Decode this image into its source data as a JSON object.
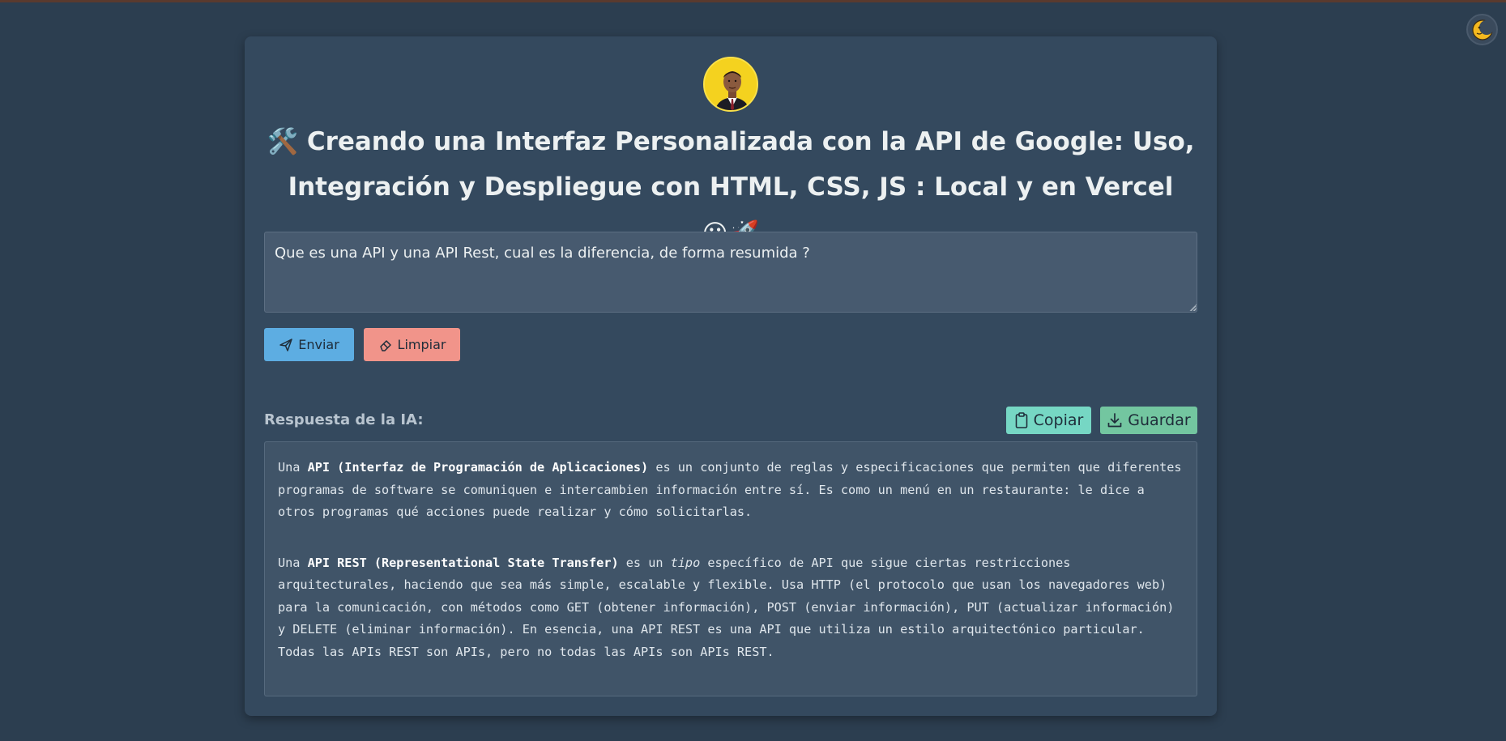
{
  "page": {
    "title_part1": "🛠️ Creando una Interfaz Personalizada con la API de Google: Uso,",
    "title_part2": "Integración y Despliegue con HTML, CSS, JS : Local y en Vercel",
    "title_emojis": "😃🚀"
  },
  "prompt": {
    "value": "Que es una API y una API Rest, cual es la diferencia, de forma resumida ?"
  },
  "actions": {
    "send_label": "Enviar",
    "clear_label": "Limpiar",
    "copy_label": "Copiar",
    "save_label": "Guardar"
  },
  "response": {
    "label": "Respuesta de la IA:",
    "p1_pre": "Una ",
    "p1_bold": "API (Interfaz de Programación de Aplicaciones)",
    "p1_post": " es un conjunto de reglas y especificaciones que permiten que diferentes programas de software se comuniquen e intercambien información entre sí.  Es como un menú en un restaurante: le dice a otros programas qué acciones puede realizar y cómo solicitarlas.",
    "p2_pre": "Una ",
    "p2_bold": "API REST (Representational State Transfer)",
    "p2_mid": " es un ",
    "p2_italic": "tipo",
    "p2_post": " específico de API que sigue ciertas restricciones arquitecturales, haciendo que sea más simple, escalable y flexible.  Usa HTTP (el protocolo que usan los navegadores web) para la comunicación, con métodos como GET (obtener información), POST (enviar información), PUT (actualizar información) y DELETE (eliminar información).  En esencia, una API REST es una API que utiliza un estilo arquitectónico particular.  Todas las APIs REST son APIs, pero no todas las APIs son APIs REST."
  },
  "icons": {
    "theme": "moon-icon",
    "send": "paper-plane-icon",
    "clear": "eraser-icon",
    "copy": "clipboard-icon",
    "save": "download-icon"
  },
  "colors": {
    "background": "#2c3e50",
    "card": "#34495e",
    "send": "#5dade2",
    "clear": "#f1948a",
    "copy": "#76d7c4",
    "save": "#73c6a0"
  }
}
